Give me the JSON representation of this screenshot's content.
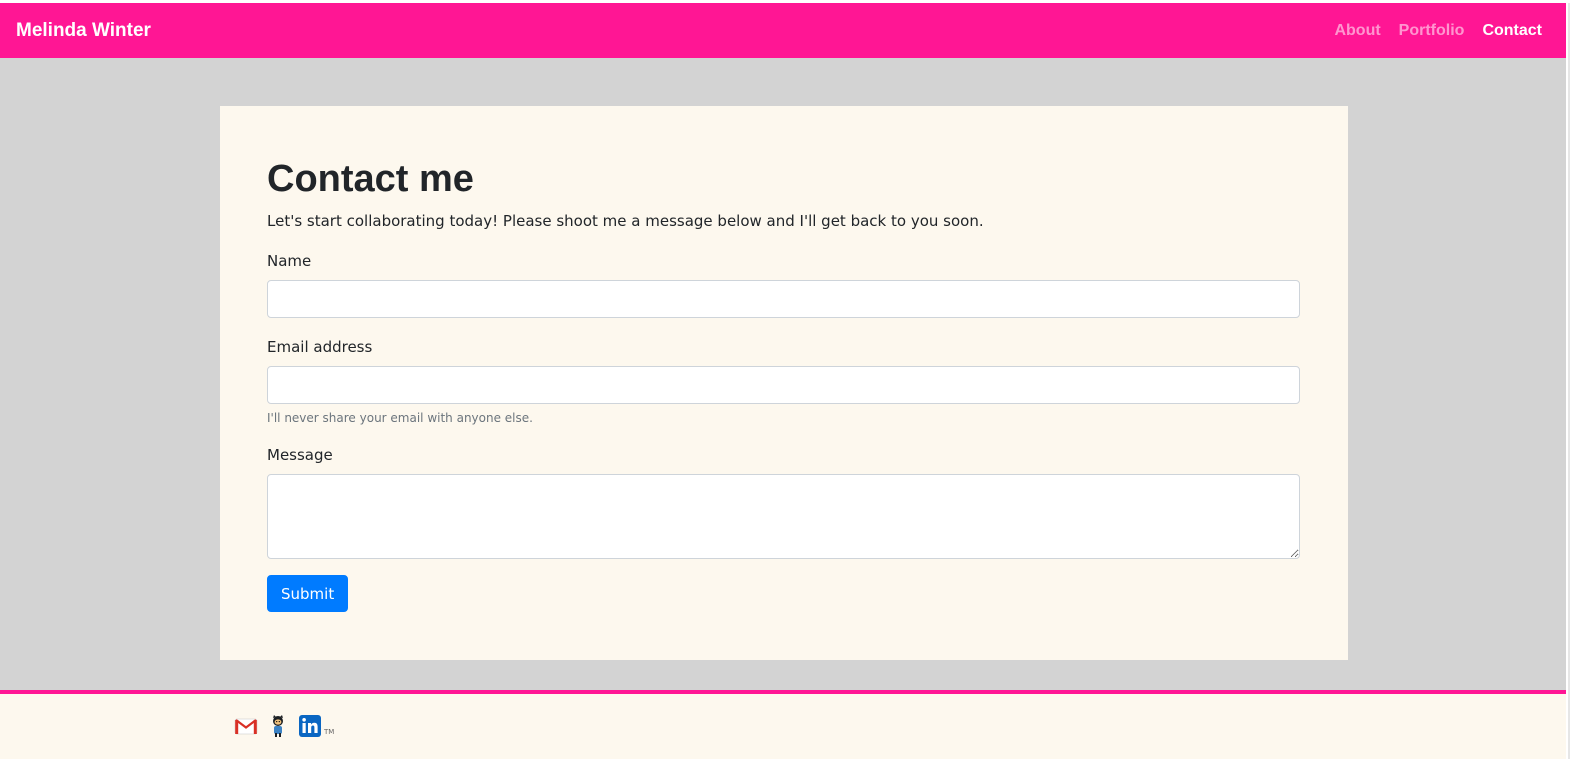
{
  "navbar": {
    "brand": "Melinda Winter",
    "links": [
      {
        "label": "About",
        "active": false
      },
      {
        "label": "Portfolio",
        "active": false
      },
      {
        "label": "Contact",
        "active": true
      }
    ],
    "color": "#ff1694"
  },
  "main": {
    "title": "Contact me",
    "intro": "Let's start collaborating today! Please shoot me a message below and I'll get back to you soon.",
    "form": {
      "name_label": "Name",
      "name_value": "",
      "email_label": "Email address",
      "email_value": "",
      "email_help": "I'll never share your email with anyone else.",
      "message_label": "Message",
      "message_value": "",
      "submit_label": "Submit"
    }
  },
  "footer": {
    "icons": [
      "gmail-icon",
      "github-icon",
      "linkedin-icon"
    ],
    "linkedin_tm": "TM"
  },
  "colors": {
    "accent": "#ff1694",
    "page_bg": "#d3d3d3",
    "card_bg": "#fdf8ee",
    "button": "#007bff"
  }
}
